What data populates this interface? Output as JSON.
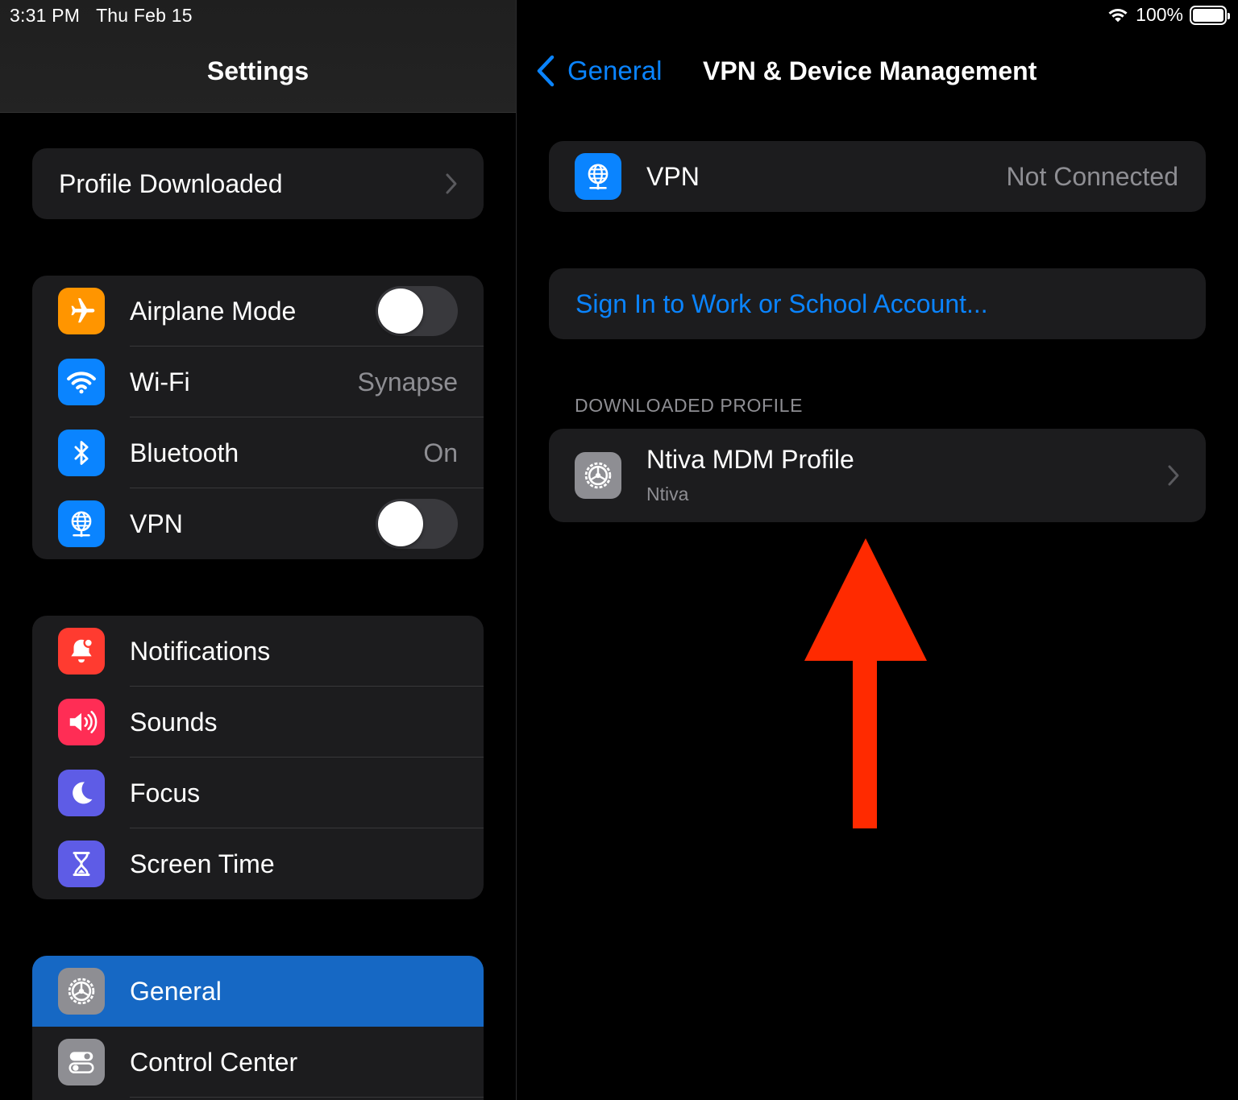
{
  "status_bar": {
    "time": "3:31 PM",
    "date": "Thu Feb 15",
    "battery": "100%"
  },
  "sidebar": {
    "title": "Settings",
    "profile_banner": "Profile Downloaded",
    "connectivity": [
      {
        "label": "Airplane Mode",
        "icon": "airplane-icon",
        "toggle": false,
        "color": "#ff9500"
      },
      {
        "label": "Wi-Fi",
        "value": "Synapse",
        "icon": "wifi-icon",
        "color": "#0a84ff"
      },
      {
        "label": "Bluetooth",
        "value": "On",
        "icon": "bluetooth-icon",
        "color": "#0a84ff"
      },
      {
        "label": "VPN",
        "icon": "vpn-globe-icon",
        "toggle": false,
        "color": "#0a84ff"
      }
    ],
    "alerts": [
      {
        "label": "Notifications",
        "icon": "bell-icon",
        "color": "#ff3b30"
      },
      {
        "label": "Sounds",
        "icon": "speaker-icon",
        "color": "#ff2d55"
      },
      {
        "label": "Focus",
        "icon": "moon-icon",
        "color": "#5e5ce6"
      },
      {
        "label": "Screen Time",
        "icon": "hourglass-icon",
        "color": "#5e5ce6"
      }
    ],
    "system": [
      {
        "label": "General",
        "icon": "gear-icon",
        "selected": true,
        "color": "#8e8e93"
      },
      {
        "label": "Control Center",
        "icon": "switches-icon",
        "color": "#8e8e93"
      }
    ]
  },
  "detail": {
    "back_label": "General",
    "title": "VPN & Device Management",
    "vpn": {
      "label": "VPN",
      "value": "Not Connected"
    },
    "sign_in_link": "Sign In to Work or School Account...",
    "downloaded_section_header": "DOWNLOADED PROFILE",
    "profile": {
      "name": "Ntiva MDM Profile",
      "org": "Ntiva"
    },
    "annotation_color": "#ff2a00"
  }
}
